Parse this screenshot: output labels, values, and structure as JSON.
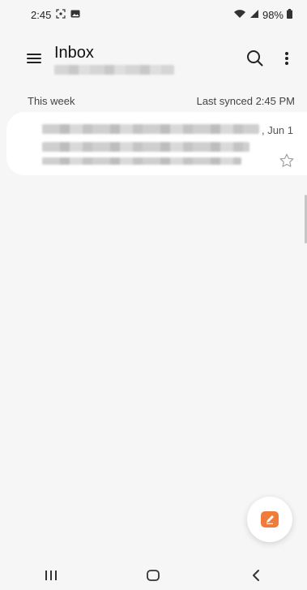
{
  "status_bar": {
    "time": "2:45",
    "battery": "98%",
    "icons": [
      "screenshot-icon",
      "gallery-icon",
      "wifi-icon",
      "signal-icon",
      "battery-icon"
    ]
  },
  "header": {
    "title": "Inbox",
    "account_redacted": true,
    "icons": [
      "menu-icon",
      "search-icon",
      "more-vert-icon"
    ]
  },
  "section": {
    "label": "This week",
    "sync_status": "Last synced  2:45 PM"
  },
  "emails": [
    {
      "date": ", Jun 1",
      "sender_redacted": true,
      "preview_redacted": true,
      "starred": false
    }
  ],
  "compose": {
    "icon": "compose-icon",
    "accent": "#f07c3c"
  },
  "nav": {
    "icons": [
      "recents-icon",
      "home-icon",
      "back-icon"
    ]
  },
  "colors": {
    "background": "#f6f6f6",
    "card": "#ffffff",
    "accent": "#f07c3c"
  }
}
